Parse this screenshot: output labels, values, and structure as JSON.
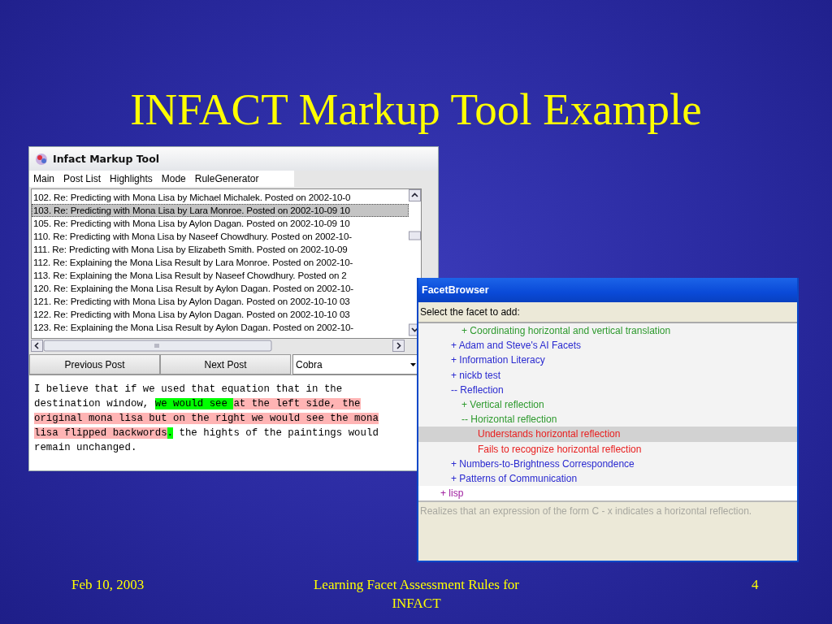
{
  "slide": {
    "title": "INFACT Markup Tool Example",
    "footer_date": "Feb 10, 2003",
    "footer_center": "Learning Facet Assessment Rules for INFACT",
    "page_number": "4"
  },
  "markup_window": {
    "title": "Infact Markup Tool",
    "menu": [
      "Main",
      "Post List",
      "Highlights",
      "Mode",
      "RuleGenerator"
    ],
    "posts": [
      {
        "text": "102. Re: Predicting with Mona Lisa by Michael Michalek.  Posted on  2002-10-0",
        "selected": false
      },
      {
        "text": "103. Re: Predicting with Mona Lisa by Lara Monroe.  Posted on  2002-10-09 10",
        "selected": true
      },
      {
        "text": "105. Re: Predicting with Mona Lisa by Aylon Dagan.  Posted on  2002-10-09 10",
        "selected": false
      },
      {
        "text": "110. Re: Predicting with Mona Lisa by Naseef Chowdhury.  Posted on  2002-10-",
        "selected": false
      },
      {
        "text": "111. Re: Predicting with Mona Lisa by Elizabeth Smith.  Posted on  2002-10-09",
        "selected": false
      },
      {
        "text": "112. Re: Explaining the Mona Lisa Result by Lara Monroe.  Posted on  2002-10-",
        "selected": false
      },
      {
        "text": "113. Re: Explaining the Mona Lisa Result by Naseef Chowdhury.  Posted on  2",
        "selected": false
      },
      {
        "text": "120. Re: Explaining the Mona Lisa Result by Aylon Dagan.  Posted on  2002-10-",
        "selected": false
      },
      {
        "text": "121. Re: Predicting with Mona Lisa by Aylon Dagan.  Posted on  2002-10-10 03",
        "selected": false
      },
      {
        "text": "122. Re: Predicting with Mona Lisa by Aylon Dagan.  Posted on  2002-10-10 03",
        "selected": false
      },
      {
        "text": "123. Re: Explaining the Mona Lisa Result by Aylon Dagan.  Posted on  2002-10-",
        "selected": false
      }
    ],
    "buttons": [
      "Previous Post",
      "Next Post"
    ],
    "combo_value": "Cobra",
    "post_body": [
      {
        "text": "I believe that if we used that equation that in the destination window, "
      },
      {
        "text": "we would see ",
        "color": "#00ff00"
      },
      {
        "text": "at the left side, the original mona lisa but on the right we would see the mona lisa flipped backwords",
        "color": "#ffb4b4"
      },
      {
        "text": ".",
        "color": "#00ff00"
      },
      {
        "text": " the hights of the paintings would remain unchanged."
      }
    ]
  },
  "facet_window": {
    "title": "FacetBrowser",
    "prompt": "Select the facet to add:",
    "tree": [
      {
        "children": [
          {
            "children": [
              {
                "label": "+ Coordinating horizontal and vertical translation",
                "color": "#2e9a2e",
                "selected": false
              }
            ]
          },
          {
            "label": "+ Adam and Steve's AI Facets",
            "color": "#2a2ad0",
            "selected": false
          },
          {
            "label": "+ Information Literacy",
            "color": "#2a2ad0",
            "selected": false
          },
          {
            "label": "+ nickb test",
            "color": "#2a2ad0",
            "selected": false
          },
          {
            "label": "-- Reflection",
            "color": "#2a2ad0",
            "selected": false,
            "children": [
              {
                "label": "+ Vertical reflection",
                "color": "#2e9a2e",
                "selected": false
              },
              {
                "label": "-- Horizontal reflection",
                "color": "#2e9a2e",
                "selected": false,
                "children": [
                  {
                    "label": "Understands horizontal reflection",
                    "color": "#e82020",
                    "selected": true
                  },
                  {
                    "label": "Fails to recognize horizontal reflection",
                    "color": "#e82020",
                    "selected": false
                  }
                ]
              }
            ]
          },
          {
            "label": "+ Numbers-to-Brightness Correspondence",
            "color": "#2a2ad0",
            "selected": false
          },
          {
            "label": "+ Patterns of Communication",
            "color": "#2a2ad0",
            "selected": false
          }
        ]
      },
      {
        "label": "+ lisp",
        "color": "#a020a0",
        "selected": false
      }
    ],
    "description": "Realizes that an expression of the form C - x  indicates a horizontal reflection."
  }
}
